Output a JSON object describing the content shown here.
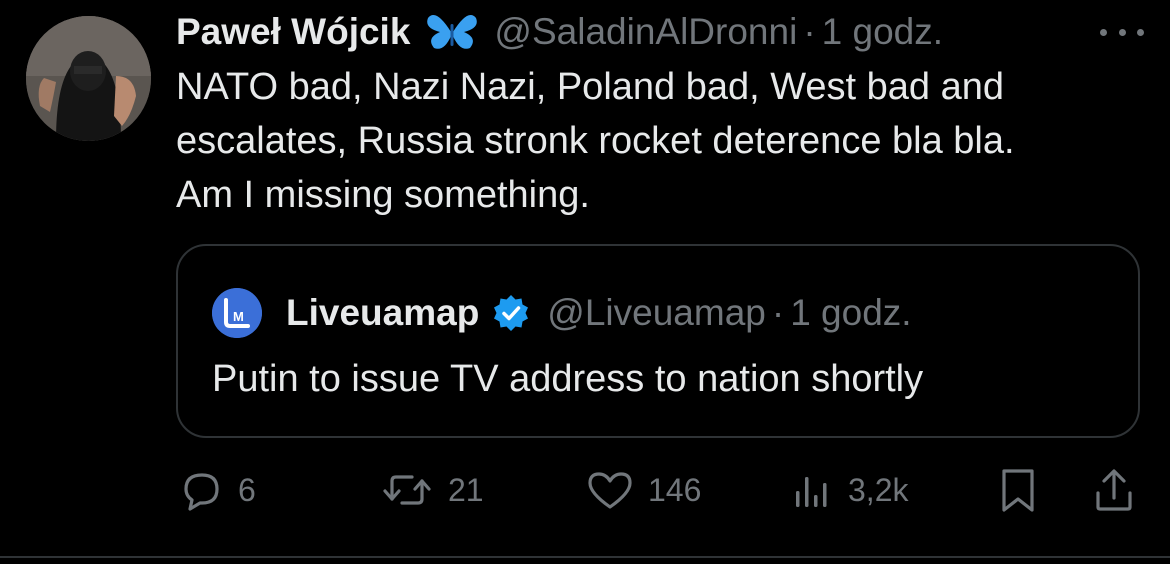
{
  "tweet": {
    "author_name": "Paweł Wójcik",
    "author_badge_icon": "butterfly-emoji-icon",
    "handle": "@SaladinAlDronni",
    "separator": "·",
    "time": "1 godz.",
    "more_icon": "more-horizontal-icon",
    "text": "NATO bad, Nazi Nazi, Poland bad, West bad and\nescalates, Russia stronk rocket deterence bla bla.\nAm I missing something."
  },
  "quote": {
    "author_name": "Liveuamap",
    "avatar_icon": "liveuamap-logo-icon",
    "verified_icon": "verified-badge-icon",
    "handle": "@Liveuamap",
    "separator": "·",
    "time": "1 godz.",
    "text": "Putin to issue TV address to nation shortly"
  },
  "actions": {
    "replies": "6",
    "reposts": "21",
    "likes": "146",
    "views": "3,2k"
  },
  "colors": {
    "background": "#000000",
    "text": "#e7e9ea",
    "muted": "#71767b",
    "border": "#2f3336",
    "verified_blue": "#1d9bf0",
    "butterfly_blue": "#3aa0f0",
    "liveuamap_blue": "#3b6fd8"
  }
}
